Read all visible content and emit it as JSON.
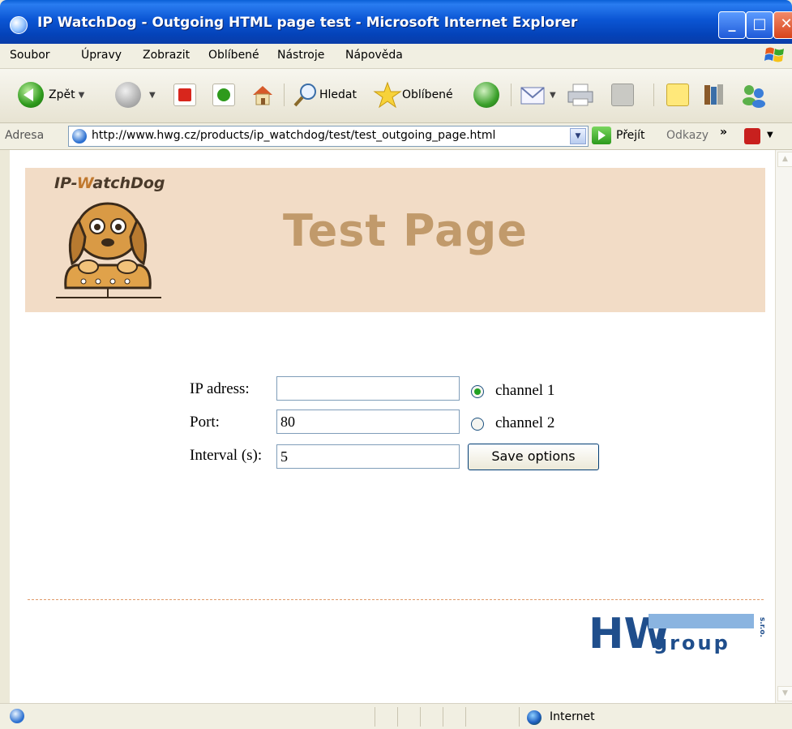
{
  "window": {
    "title": "IP WatchDog - Outgoing HTML page test - Microsoft Internet Explorer",
    "minimize": "_",
    "maximize": "□",
    "close": "✕"
  },
  "menu": [
    "Soubor",
    "Úpravy",
    "Zobrazit",
    "Oblíbené",
    "Nástroje",
    "Nápověda"
  ],
  "toolbar": {
    "back_label": "Zpět",
    "search_label": "Hledat",
    "favorites_label": "Oblíbené"
  },
  "address": {
    "label": "Adresa",
    "url": "http://www.hwg.cz/products/ip_watchdog/test/test_outgoing_page.html",
    "go_label": "Přejít",
    "links_label": "Odkazy",
    "more": "»"
  },
  "page": {
    "logo_text_a": "IP-",
    "logo_text_w": "W",
    "logo_text_b": "atchDog",
    "title": "Test Page",
    "form": {
      "ip_label": "IP adress:",
      "ip_value": "",
      "port_label": "Port:",
      "port_value": "80",
      "interval_label": "Interval (s):",
      "interval_value": "5",
      "channel1_label": "channel 1",
      "channel2_label": "channel 2",
      "channel_selected": "channel 1",
      "save_label": "Save options"
    },
    "footer_logo": {
      "big": "HW",
      "small": "group",
      "suffix": "s.r.o."
    }
  },
  "status": {
    "zone_label": "Internet"
  }
}
